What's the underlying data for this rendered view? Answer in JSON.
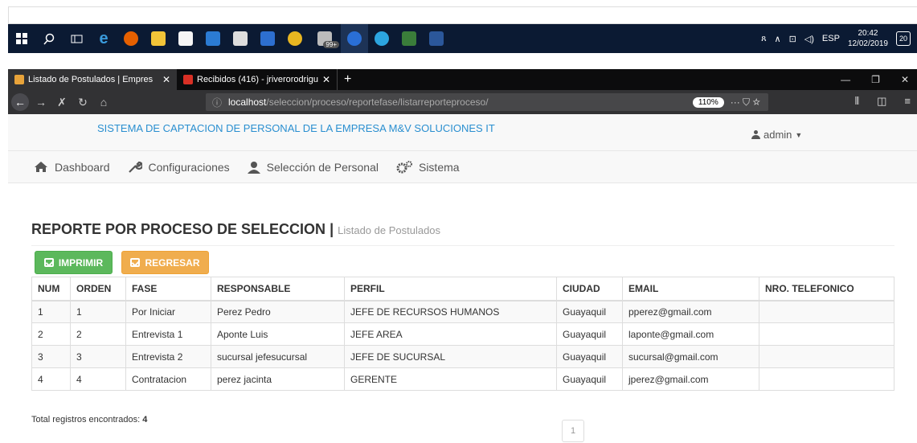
{
  "taskbar": {
    "keyboard_label": "ESP",
    "time": "20:42",
    "date": "12/02/2019",
    "notifications": "20",
    "mail_badge": "99+"
  },
  "browser": {
    "tabs": [
      {
        "title": "Listado de Postulados | Empres",
        "close": "✕"
      },
      {
        "title": "Recibidos (416) - jriverorodrigu",
        "close": "✕"
      }
    ],
    "new_tab": "+",
    "url_host": "localhost",
    "url_path": "/seleccion/proceso/reportefase/listarreporteproceso/",
    "zoom": "110%",
    "page_actions": "··· ⛉ ☆"
  },
  "app": {
    "system_title": "SISTEMA DE CAPTACION DE PERSONAL DE LA EMPRESA M&V SOLUCIONES IT",
    "user": "admin",
    "menu": [
      {
        "label": "Dashboard",
        "icon": "home-icon"
      },
      {
        "label": "Configuraciones",
        "icon": "wrench-icon"
      },
      {
        "label": "Selección de Personal",
        "icon": "user-icon"
      },
      {
        "label": "Sistema",
        "icon": "gears-icon"
      }
    ]
  },
  "report": {
    "title": "REPORTE POR PROCESO DE SELECCION",
    "separator": " | ",
    "subtitle": "Listado de Postulados",
    "print_label": "IMPRIMIR",
    "back_label": "REGRESAR",
    "columns": [
      "NUM",
      "ORDEN",
      "FASE",
      "RESPONSABLE",
      "PERFIL",
      "CIUDAD",
      "EMAIL",
      "NRO. TELEFONICO"
    ],
    "rows": [
      [
        "1",
        "1",
        "Por Iniciar",
        "Perez Pedro",
        "JEFE DE RECURSOS HUMANOS",
        "Guayaquil",
        "pperez@gmail.com",
        ""
      ],
      [
        "2",
        "2",
        "Entrevista 1",
        "Aponte Luis",
        "JEFE AREA",
        "Guayaquil",
        "laponte@gmail.com",
        ""
      ],
      [
        "3",
        "3",
        "Entrevista 2",
        "sucursal jefesucursal",
        "JEFE DE SUCURSAL",
        "Guayaquil",
        "sucursal@gmail.com",
        ""
      ],
      [
        "4",
        "4",
        "Contratacion",
        "perez jacinta",
        "GERENTE",
        "Guayaquil",
        "jperez@gmail.com",
        ""
      ]
    ],
    "total_label": "Total registros encontrados:",
    "total_count": "4",
    "page": "1"
  },
  "colors": {
    "title_blue": "#2a8fd0",
    "print_green": "#5cb85c",
    "back_orange": "#f0ad4e",
    "taskbar": "#0b1a33"
  }
}
